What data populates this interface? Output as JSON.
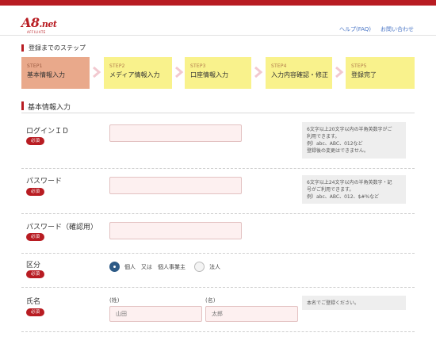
{
  "header": {
    "logo_main": "A8",
    "logo_net": ".net",
    "logo_sub": "AFFILIATE",
    "links": [
      "ヘルプ(FAQ)",
      "お問い合わせ"
    ]
  },
  "steps_title": "登録までのステップ",
  "steps": [
    {
      "num": "STEP1",
      "title": "基本情報入力",
      "active": true
    },
    {
      "num": "STEP2",
      "title": "メディア情報入力",
      "active": false
    },
    {
      "num": "STEP3",
      "title": "口座情報入力",
      "active": false
    },
    {
      "num": "STEP4",
      "title": "入力内容確認・修正",
      "active": false
    },
    {
      "num": "STEP5",
      "title": "登録完了",
      "active": false
    }
  ],
  "form_title": "基本情報入力",
  "required_badge": "必須",
  "fields": {
    "login_id": {
      "label": "ログインＩＤ",
      "value": "",
      "hint": [
        "6文字以上20文字以内の半角英数字がご",
        "利用できます。",
        "例）abc、ABC、012など",
        "登録後の変更はできません。"
      ]
    },
    "password": {
      "label": "パスワード",
      "value": "",
      "hint": [
        "6文字以上24文字以内の半角英数字・記",
        "号がご利用できます。",
        "例）abc、ABC、012、$#%など"
      ]
    },
    "password_confirm": {
      "label": "パスワード（確認用）",
      "value": ""
    },
    "category": {
      "label": "区分",
      "options": [
        {
          "label": "個人　又は　個人事業主",
          "selected": true
        },
        {
          "label": "法人",
          "selected": false
        }
      ]
    },
    "name": {
      "label": "氏名",
      "sei_label": "(姓)",
      "mei_label": "(名)",
      "sei_placeholder": "山田",
      "mei_placeholder": "太郎",
      "hint": [
        "本名でご登録ください。"
      ]
    }
  },
  "colors": {
    "brand_red": "#b81c22",
    "step_active": "#e9a98b",
    "step_inactive": "#f9f28c",
    "input_bg": "#fdf0f0",
    "radio_selected": "#2d5a86",
    "chevron": "#f2c9d0"
  }
}
